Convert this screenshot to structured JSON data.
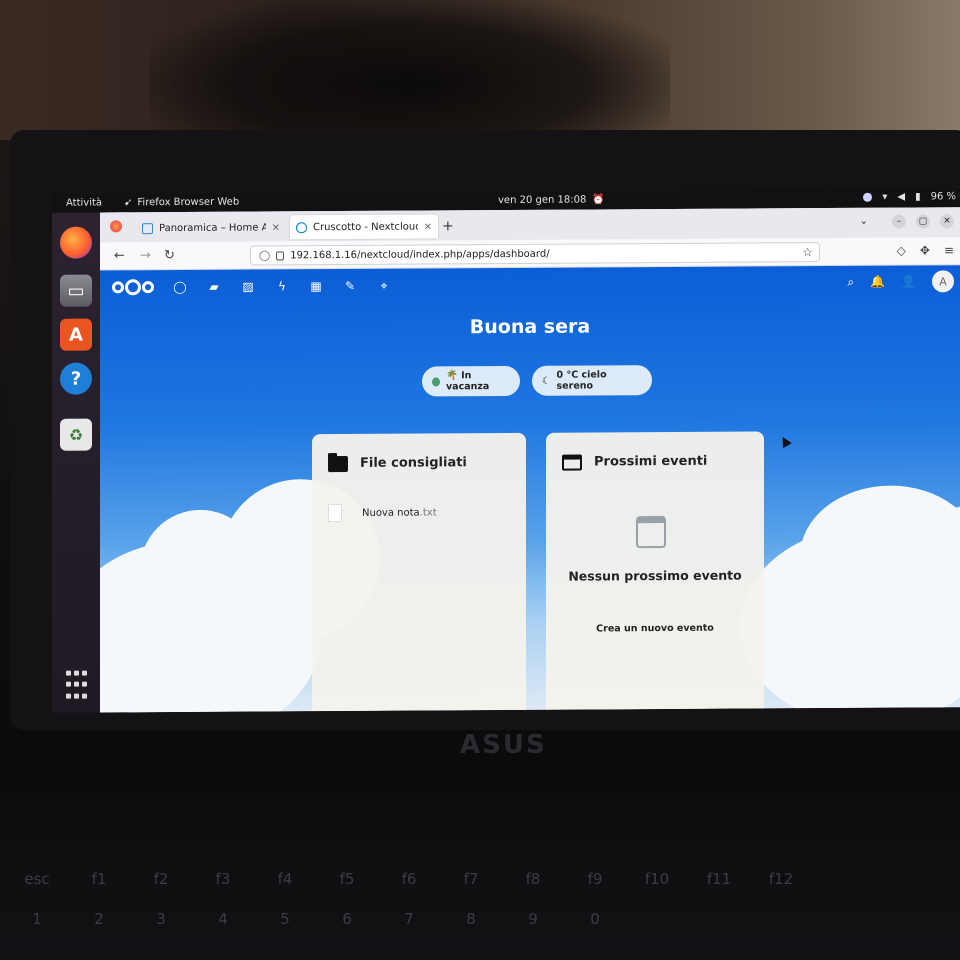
{
  "topbar": {
    "activities": "Attività",
    "app_name": "Firefox Browser Web",
    "clock": "ven 20 gen  18:08",
    "battery": "96 %"
  },
  "dock": {
    "items": [
      "firefox-icon",
      "files-icon",
      "software-store-icon",
      "help-icon",
      "trash-icon",
      "app-grid-icon"
    ]
  },
  "browser": {
    "tabs": [
      {
        "title": "Panoramica – Home Assis",
        "close": "×"
      },
      {
        "title": "Cruscotto - Nextcloud",
        "close": "×"
      }
    ],
    "new_tab": "+",
    "url": "192.168.1.16/nextcloud/index.php/apps/dashboard/"
  },
  "nextcloud": {
    "greeting": "Buona sera",
    "status": "🌴 In vacanza",
    "weather": "0 °C cielo sereno",
    "avatar_initial": "A",
    "files_card": {
      "title": "File consigliati",
      "files": [
        {
          "name": "Nuova nota",
          "ext": ".txt"
        }
      ]
    },
    "events_card": {
      "title": "Prossimi eventi",
      "empty_title": "Nessun prossimo evento",
      "create_label": "Crea un nuovo evento"
    }
  },
  "hardware": {
    "brand": "ASUS"
  }
}
